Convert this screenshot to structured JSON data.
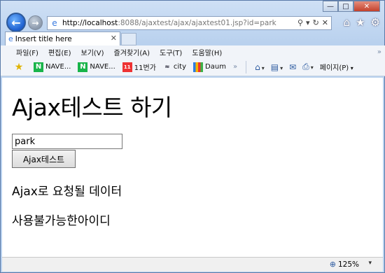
{
  "browser": {
    "url_host": "http://localhost",
    "url_rest": ":8088/ajaxtest/ajax/ajaxtest01.jsp?id=park",
    "tab_title": "Insert title here"
  },
  "menu": [
    "파일(F)",
    "편집(E)",
    "보기(V)",
    "즐겨찾기(A)",
    "도구(T)",
    "도움말(H)"
  ],
  "favorites": {
    "items": [
      {
        "label": "NAVE...",
        "icon": "naver-icon"
      },
      {
        "label": "NAVE...",
        "icon": "naver-icon"
      },
      {
        "label": "11번가",
        "icon": "11st-icon"
      },
      {
        "label": "city",
        "icon": "citi-icon"
      },
      {
        "label": "Daum",
        "icon": "daum-icon"
      }
    ],
    "page_menu": "페이지(P)"
  },
  "page": {
    "heading": "Ajax테스트 하기",
    "input_value": "park",
    "button_label": "Ajax테스트",
    "status_line1": "Ajax로 요청될 데이터",
    "status_line2": "사용불가능한아이디"
  },
  "statusbar": {
    "zoom": "125%"
  }
}
